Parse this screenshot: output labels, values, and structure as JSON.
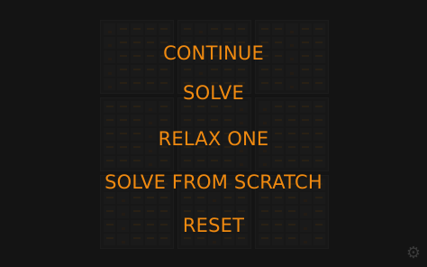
{
  "menu": {
    "items": [
      {
        "label": "CONTINUE"
      },
      {
        "label": "SOLVE"
      },
      {
        "label": "RELAX ONE"
      },
      {
        "label": "SOLVE FROM SCRATCH"
      },
      {
        "label": "RESET"
      }
    ]
  },
  "settings": {
    "icon": "gear-icon"
  },
  "colors": {
    "background": "#141414",
    "menu_text": "#f08a10",
    "board_dim": "#1b1b1b"
  }
}
